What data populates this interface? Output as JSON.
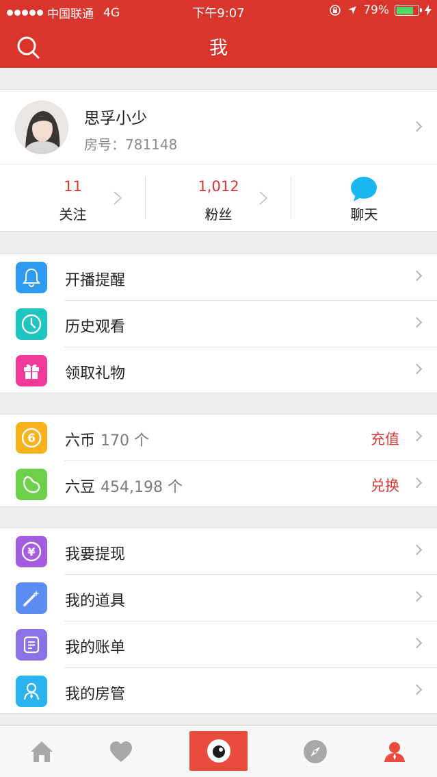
{
  "status_bar": {
    "carrier": "中国联通",
    "network": "4G",
    "time": "下午9:07",
    "battery": "79%",
    "battery_level": 0.79
  },
  "nav": {
    "title": "我"
  },
  "profile": {
    "name": "思孚小少",
    "room": "房号：781148"
  },
  "stats": {
    "follow_count": "11",
    "follow_label": "关注",
    "fans_count": "1,012",
    "fans_label": "粉丝",
    "chat_label": "聊天"
  },
  "menu_group1": [
    {
      "label": "开播提醒",
      "icon": "bell-icon",
      "color": "#2f9bf0"
    },
    {
      "label": "历史观看",
      "icon": "clock-icon",
      "color": "#1fc5c0"
    },
    {
      "label": "领取礼物",
      "icon": "gift-icon",
      "color": "#f03a9a"
    }
  ],
  "currency": [
    {
      "label": "六币",
      "amount": "170 个",
      "action": "充值",
      "icon": "six-coin-icon",
      "color": "#f7b21c"
    },
    {
      "label": "六豆",
      "amount": "454,198 个",
      "action": "兑换",
      "icon": "bean-icon",
      "color": "#6dd04a"
    }
  ],
  "menu_group3": [
    {
      "label": "我要提现",
      "icon": "withdraw-icon",
      "color": "#a35ce0"
    },
    {
      "label": "我的道具",
      "icon": "magic-wand-icon",
      "color": "#5b8df2"
    },
    {
      "label": "我的账单",
      "icon": "bill-icon",
      "color": "#8a72e6"
    },
    {
      "label": "我的房管",
      "icon": "room-manager-icon",
      "color": "#29b3ef"
    }
  ],
  "tabs": [
    "home-tab-icon",
    "heart-tab-icon",
    "live-tab-icon",
    "explore-tab-icon",
    "profile-tab-icon"
  ],
  "colors": {
    "brand_red": "#d9352c",
    "chat_blue": "#1ab6f0"
  }
}
